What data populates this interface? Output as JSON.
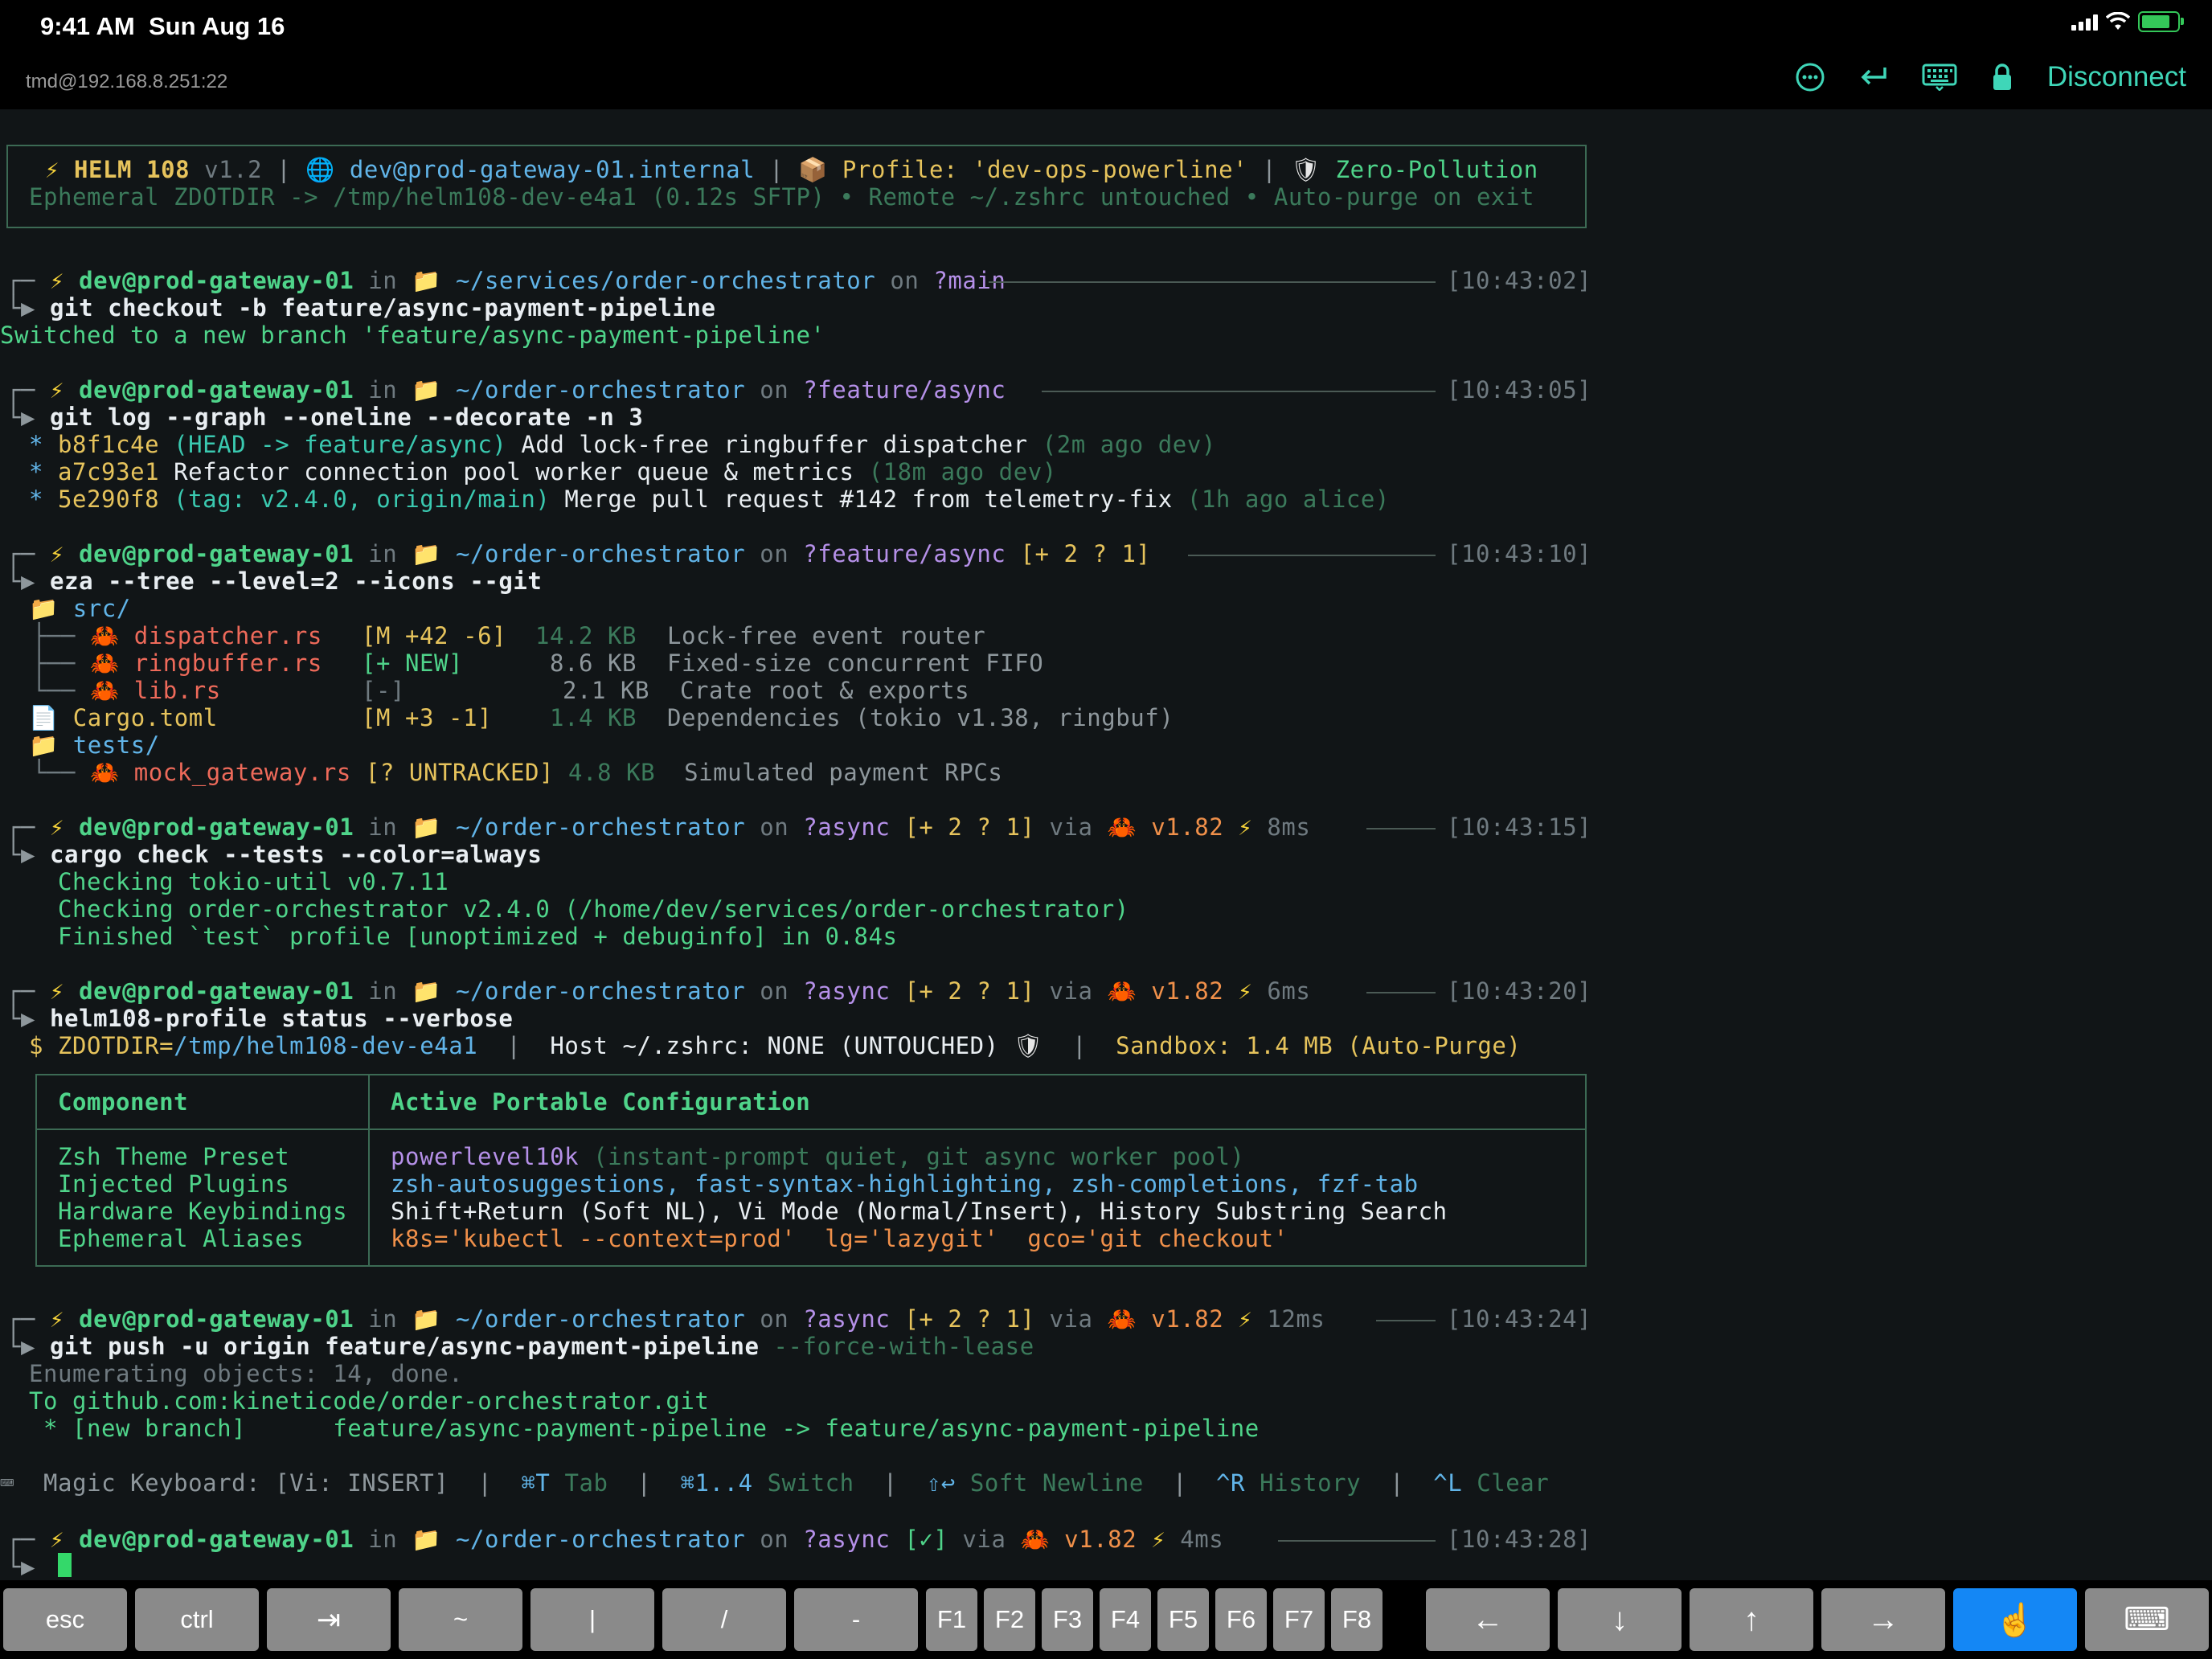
{
  "status_bar": {
    "time": "9:41 AM",
    "date": "Sun Aug 16"
  },
  "top_bar": {
    "host": "tmd@192.168.8.251:22",
    "icons": [
      "more-icon",
      "return-icon",
      "keyboard-icon",
      "lock-icon"
    ],
    "disconnect": "Disconnect"
  },
  "banner": {
    "bolt": "⚡",
    "name": "HELM 108",
    "version": "v1.2",
    "sep": "|",
    "globe": "🌐",
    "host": "dev@prod-gateway-01.internal",
    "box": "📦",
    "profile": "Profile: 'dev-ops-powerline'",
    "shield": "🛡",
    "zero": "Zero-Pollution",
    "line2": "Ephemeral ZDOTDIR -> /tmp/helm108-dev-e4a1 (0.12s SFTP) • Remote ~/.zshrc untouched • Auto-purge on exit"
  },
  "prompt": {
    "corner": "┌─",
    "arrow": "└▶",
    "bolt": "⚡",
    "user": "dev@prod-gateway-01",
    "in": "in",
    "folder": "📁",
    "on": "on",
    "branch_icon": "?",
    "via": "via",
    "crab": "🦀",
    "rust": "v1.82"
  },
  "blocks": [
    {
      "path": "~/services/order-orchestrator",
      "branch": "main",
      "time": "[10:43:02]",
      "cmd": "git checkout -b feature/async-payment-pipeline"
    },
    {
      "path": "~/order-orchestrator",
      "branch": "feature/async",
      "time": "[10:43:05]",
      "cmd": "git log --graph --oneline --decorate -n 3"
    },
    {
      "path": "~/order-orchestrator",
      "branch": "feature/async",
      "status": "[+ 2 ? 1]",
      "time": "[10:43:10]",
      "cmd": "eza --tree --level=2 --icons --git"
    },
    {
      "path": "~/order-orchestrator",
      "branch": "async",
      "status": "[+ 2 ? 1]",
      "dur": "8ms",
      "time": "[10:43:15]",
      "cmd": "cargo check --tests --color=always"
    },
    {
      "path": "~/order-orchestrator",
      "branch": "async",
      "status": "[+ 2 ? 1]",
      "dur": "6ms",
      "time": "[10:43:20]",
      "cmd": "helm108-profile status --verbose"
    },
    {
      "path": "~/order-orchestrator",
      "branch": "async",
      "status": "[+ 2 ? 1]",
      "dur": "12ms",
      "time": "[10:43:24]",
      "cmd": "git push -u origin feature/async-payment-pipeline",
      "cmd_flag": "--force-with-lease"
    },
    {
      "path": "~/order-orchestrator",
      "branch": "async",
      "status": "[✓]",
      "dur": "4ms",
      "time": "[10:43:28]"
    }
  ],
  "checkout_output": "Switched to a new branch 'feature/async-payment-pipeline'",
  "git_log": [
    {
      "star": "*",
      "hash": "b8f1c4e",
      "refs": "(HEAD -> feature/async)",
      "msg": "Add lock-free ringbuffer dispatcher",
      "meta": "(2m ago dev)"
    },
    {
      "star": "*",
      "hash": "a7c93e1",
      "refs": "",
      "msg": "Refactor connection pool worker queue & metrics",
      "meta": "(18m ago dev)"
    },
    {
      "star": "*",
      "hash": "5e290f8",
      "refs": "(tag: v2.4.0, origin/main)",
      "msg": "Merge pull request #142 from telemetry-fix",
      "meta": "(1h ago alice)"
    }
  ],
  "tree": {
    "src": "src/",
    "branch_mid": "├──",
    "branch_end": "└──",
    "files": [
      {
        "name": "dispatcher.rs",
        "git": "[M +42 -6]",
        "size": "14.2 KB",
        "desc": "Lock-free event router"
      },
      {
        "name": "ringbuffer.rs",
        "git": "[+ NEW]",
        "size": "8.6 KB",
        "desc": "Fixed-size concurrent FIFO"
      },
      {
        "name": "lib.rs",
        "git": "[-]",
        "size": "2.1 KB",
        "desc": "Crate root & exports"
      }
    ],
    "doc_icon": "📄",
    "cargo": {
      "name": "Cargo.toml",
      "git": "[M +3 -1]",
      "size": "1.4 KB",
      "desc": "Dependencies (tokio v1.38, ringbuf)"
    },
    "tests": "tests/",
    "mock": {
      "name": "mock_gateway.rs",
      "git": "[? UNTRACKED]",
      "size": "4.8 KB",
      "desc": "Simulated payment RPCs"
    }
  },
  "cargo_output": [
    {
      "verb": "Checking",
      "rest": "tokio-util v0.7.11"
    },
    {
      "verb": "Checking",
      "rest": "order-orchestrator v2.4.0 (/home/dev/services/order-orchestrator)"
    },
    {
      "verb": "Finished",
      "rest": "`test` profile [unoptimized + debuginfo] in 0.84s"
    }
  ],
  "profile_status": {
    "dollar": "$",
    "zdot_key": "ZDOTDIR=",
    "zdot_val": "/tmp/helm108-dev-e4a1",
    "sep": "|",
    "host_rc": "Host ~/.zshrc: NONE (UNTOUCHED)",
    "shield": "🛡",
    "sandbox": "Sandbox: 1.4 MB (Auto-Purge)"
  },
  "config_table": {
    "headers": [
      "Component",
      "Active Portable Configuration"
    ],
    "rows": [
      {
        "component": "Zsh Theme Preset",
        "value": "powerlevel10k",
        "value_note": "(instant-prompt quiet, git async worker pool)"
      },
      {
        "component": "Injected Plugins",
        "value": "zsh-autosuggestions, fast-syntax-highlighting, zsh-completions, fzf-tab"
      },
      {
        "component": "Hardware Keybindings",
        "value": "Shift+Return (Soft NL), Vi Mode (Normal/Insert), History Substring Search"
      },
      {
        "component": "Ephemeral Aliases",
        "value": "k8s='kubectl --context=prod'  lg='lazygit'  gco='git checkout'"
      }
    ]
  },
  "push_output": {
    "enum": "Enumerating objects: 14, done.",
    "to": "To github.com:kineticode/order-orchestrator.git",
    "branch_line": " * [new branch]      feature/async-payment-pipeline -> feature/async-payment-pipeline"
  },
  "hint_bar": {
    "kb_icon": "⌨",
    "magic": "Magic Keyboard: [Vi: INSERT]",
    "sep": "|",
    "items": [
      {
        "key": "⌘T",
        "label": "Tab"
      },
      {
        "key": "⌘1..4",
        "label": "Switch"
      },
      {
        "key": "⇧↩",
        "label": "Soft Newline"
      },
      {
        "key": "^R",
        "label": "History"
      },
      {
        "key": "^L",
        "label": "Clear"
      }
    ]
  },
  "accessory_keys": {
    "esc": "esc",
    "ctrl": "ctrl",
    "tab": "⇥",
    "tilde": "~",
    "pipe": "|",
    "slash": "/",
    "dash": "-",
    "f1": "F1",
    "f2": "F2",
    "f3": "F3",
    "f4": "F4",
    "f5": "F5",
    "f6": "F6",
    "f7": "F7",
    "f8": "F8",
    "left": "←",
    "down": "↓",
    "up": "↑",
    "right": "→",
    "touch": "☝",
    "keyboard": "⌨"
  }
}
